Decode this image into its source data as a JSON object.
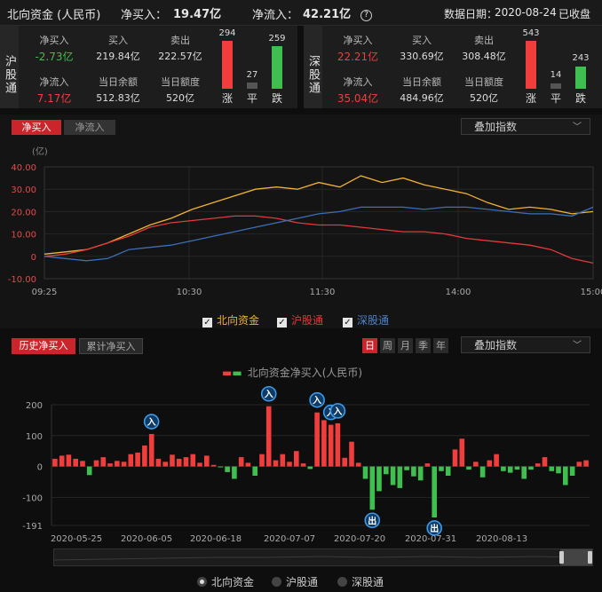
{
  "header": {
    "title": "北向资金 (人民币)",
    "net_buy_label": "净买入：",
    "net_buy_value": "19.47亿",
    "net_inflow_label": "净流入：",
    "net_inflow_value": "42.21亿",
    "date_label": "数据日期：",
    "date_value": "2020-08-24",
    "status": "已收盘"
  },
  "hu": {
    "label": "沪股通",
    "net_buy_label": "净买入",
    "net_buy": "-2.73亿",
    "buy_label": "买入",
    "buy": "219.84亿",
    "sell_label": "卖出",
    "sell": "222.57亿",
    "net_inflow_label": "净流入",
    "net_inflow": "7.17亿",
    "balance_label": "当日余额",
    "balance": "512.83亿",
    "quota_label": "当日额度",
    "quota": "520亿",
    "up": 294,
    "flat": 27,
    "down": 259,
    "up_label": "涨",
    "flat_label": "平",
    "down_label": "跌"
  },
  "shen": {
    "label": "深股通",
    "net_buy_label": "净买入",
    "net_buy": "22.21亿",
    "buy_label": "买入",
    "buy": "330.69亿",
    "sell_label": "卖出",
    "sell": "308.48亿",
    "net_inflow_label": "净流入",
    "net_inflow": "35.04亿",
    "balance_label": "当日余额",
    "balance": "484.96亿",
    "quota_label": "当日额度",
    "quota": "520亿",
    "up": 543,
    "flat": 14,
    "down": 243,
    "up_label": "涨",
    "flat_label": "平",
    "down_label": "跌"
  },
  "intraday": {
    "tab_net_buy": "净买入",
    "tab_net_inflow": "净流入",
    "overlay": "叠加指数",
    "unit": "(亿)",
    "legend": [
      "北向资金",
      "沪股通",
      "深股通"
    ]
  },
  "history": {
    "tab_history": "历史净买入",
    "tab_cumulative": "累计净买入",
    "periods": [
      "日",
      "周",
      "月",
      "季",
      "年"
    ],
    "overlay": "叠加指数",
    "legend_label": "北向资金净买入(人民币)",
    "in_label": "入",
    "out_label": "出",
    "radios": [
      "北向资金",
      "沪股通",
      "深股通"
    ]
  },
  "colors": {
    "up": "#f23d3d",
    "down": "#3fbf4f",
    "north": "#f2b233",
    "hu": "#e23a3a",
    "shen": "#3b6fb8"
  },
  "chart_data": [
    {
      "type": "line",
      "x_ticks": [
        "09:25",
        "10:30",
        "11:30",
        "14:00",
        "15:00"
      ],
      "ylim": [
        -10,
        40
      ],
      "y_ticks": [
        -10,
        0,
        10,
        20,
        30,
        40
      ],
      "y_tick_labels": [
        "-10.00",
        "0",
        "10.00",
        "20.00",
        "30.00",
        "40.00"
      ],
      "series": [
        {
          "name": "北向资金",
          "values": [
            1,
            2,
            3,
            6,
            10,
            14,
            17,
            21,
            24,
            27,
            30,
            31,
            30,
            33,
            31,
            36,
            33,
            35,
            32,
            30,
            28,
            24,
            21,
            22,
            21,
            19,
            20
          ]
        },
        {
          "name": "沪股通",
          "values": [
            0,
            1,
            3,
            6,
            9,
            13,
            15,
            16,
            17,
            18,
            18,
            17,
            15,
            14,
            14,
            13,
            12,
            11,
            11,
            10,
            8,
            7,
            6,
            5,
            3,
            -1,
            -3
          ]
        },
        {
          "name": "深股通",
          "values": [
            0,
            -1,
            -2,
            -1,
            3,
            4,
            5,
            7,
            9,
            11,
            13,
            15,
            17,
            19,
            20,
            22,
            22,
            22,
            21,
            22,
            22,
            21,
            20,
            19,
            19,
            18,
            22
          ]
        }
      ]
    },
    {
      "type": "bar",
      "name": "北向资金净买入(人民币)",
      "ylim": [
        -191,
        200
      ],
      "y_ticks": [
        -191,
        -100,
        0,
        100,
        200
      ],
      "y_tick_labels": [
        "-191",
        "-100",
        "0",
        "100",
        "200"
      ],
      "x_tick_labels": [
        "2020-05-25",
        "2020-06-05",
        "2020-06-18",
        "2020-07-07",
        "2020-07-20",
        "2020-07-31",
        "2020-08-13"
      ],
      "values": [
        25,
        35,
        38,
        25,
        18,
        -28,
        20,
        30,
        10,
        18,
        15,
        40,
        45,
        68,
        105,
        25,
        15,
        38,
        25,
        30,
        40,
        12,
        35,
        5,
        -3,
        -18,
        -40,
        30,
        12,
        -30,
        40,
        195,
        20,
        40,
        15,
        50,
        10,
        -8,
        175,
        150,
        135,
        140,
        28,
        80,
        12,
        -40,
        -140,
        -80,
        -25,
        -60,
        -70,
        -12,
        -32,
        -45,
        10,
        -165,
        -15,
        -30,
        55,
        90,
        -10,
        15,
        -35,
        20,
        40,
        -15,
        -20,
        -10,
        -40,
        -10,
        10,
        30,
        -15,
        -22,
        -60,
        -30,
        15,
        20
      ]
    }
  ]
}
